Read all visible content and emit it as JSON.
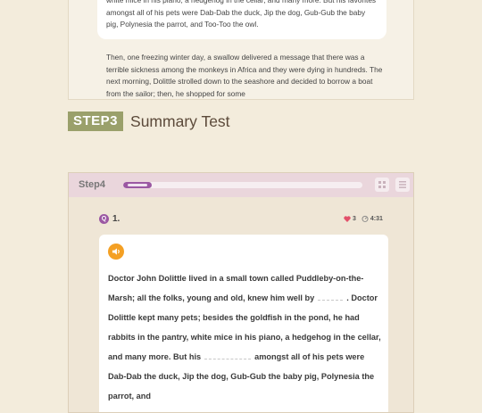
{
  "reading": {
    "bubble_text": "white mice in his piano, a hedgehog in the cellar, and many more. But his favorites amongst all of his pets were Dab-Dab the duck, Jip the dog, Gub-Gub the baby pig, Polynesia the parrot, and Too-Too the owl.",
    "passage_text": "Then, one freezing winter day, a swallow delivered a message that there was a terrible sickness among the monkeys in Africa and they were dying in hundreds. The next morning, Dolittle strolled down to the seashore and decided to borrow a boat from the sailor; then, he shopped for some"
  },
  "step3": {
    "badge": "STEP3",
    "title": "Summary Test"
  },
  "step4": {
    "label": "Step4",
    "progress_fraction": 0.12,
    "accent_color": "#9b58a3",
    "header_buttons": [
      "grid-icon",
      "list-icon"
    ]
  },
  "question": {
    "icon_letter": "Q",
    "number": "1.",
    "hearts": "3",
    "timer": "4:31",
    "audio_icon": "speaker-icon",
    "passage": {
      "part1": "Doctor John Dolittle lived in a small town called Puddleby-on-the-Marsh; all the folks, young and old, knew him well by",
      "part2": ". Doctor Dolittle kept many pets; besides the goldfish in the pond, he had rabbits in the pantry, white mice in his piano, a hedgehog in the cellar, and many more. But his",
      "part3": "amongst all of his pets were Dab-Dab the duck, Jip the dog, Gub-Gub the baby pig, Polynesia the parrot, and"
    }
  }
}
